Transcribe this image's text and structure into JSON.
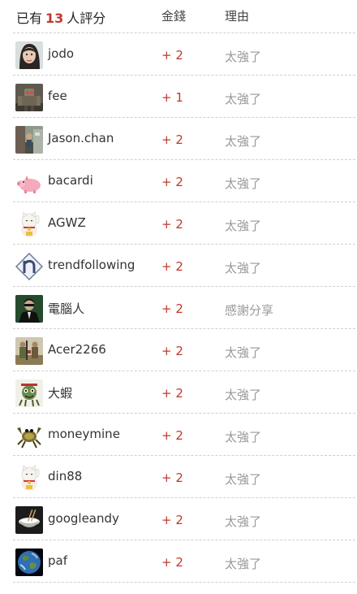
{
  "header": {
    "prefix": "已有",
    "count": "13",
    "suffix": "人評分",
    "col_money": "金錢",
    "col_reason": "理由"
  },
  "colors": {
    "money": "#c0392b",
    "reason": "#999999",
    "count": "#c0392b"
  },
  "ratings": [
    {
      "user": "jodo",
      "money": "+ 2",
      "reason": "太強了",
      "avatar_icon": "woman-portrait-avatar"
    },
    {
      "user": "fee",
      "money": "+ 1",
      "reason": "太強了",
      "avatar_icon": "robot-mech-avatar"
    },
    {
      "user": "Jason.chan",
      "money": "+ 2",
      "reason": "太強了",
      "avatar_icon": "street-photo-avatar"
    },
    {
      "user": "bacardi",
      "money": "+ 2",
      "reason": "太強了",
      "avatar_icon": "pink-pig-avatar"
    },
    {
      "user": "AGWZ",
      "money": "+ 2",
      "reason": "太強了",
      "avatar_icon": "lucky-cat-avatar"
    },
    {
      "user": "trendfollowing",
      "money": "+ 2",
      "reason": "太強了",
      "avatar_icon": "n-logo-avatar"
    },
    {
      "user": "電腦人",
      "money": "+ 2",
      "reason": "感謝分享",
      "avatar_icon": "man-in-suit-avatar"
    },
    {
      "user": "Acer2266",
      "money": "+ 2",
      "reason": "太強了",
      "avatar_icon": "soldiers-avatar"
    },
    {
      "user": "大蝦",
      "money": "+ 2",
      "reason": "太強了",
      "avatar_icon": "cartoon-creature-avatar"
    },
    {
      "user": "moneymine",
      "money": "+ 2",
      "reason": "太強了",
      "avatar_icon": "cartoon-crab-avatar"
    },
    {
      "user": "din88",
      "money": "+ 2",
      "reason": "太強了",
      "avatar_icon": "lucky-cat-avatar"
    },
    {
      "user": "googleandy",
      "money": "+ 2",
      "reason": "太強了",
      "avatar_icon": "rice-bowl-avatar"
    },
    {
      "user": "paf",
      "money": "+ 2",
      "reason": "太強了",
      "avatar_icon": "earth-globe-avatar"
    }
  ]
}
